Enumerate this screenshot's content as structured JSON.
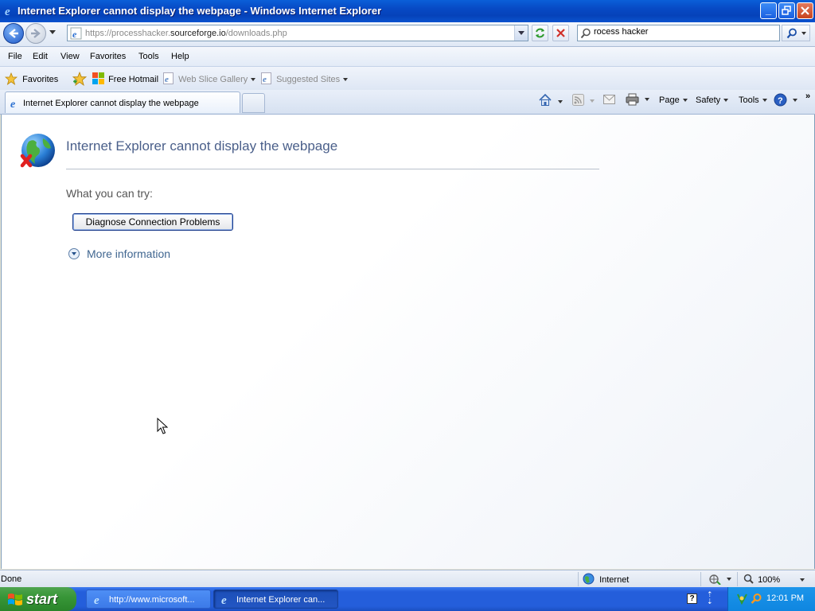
{
  "window": {
    "title": "Internet Explorer cannot display the webpage - Windows Internet Explorer"
  },
  "nav": {
    "url_prefix": "https://processhacker.",
    "url_domain": "sourceforge.io",
    "url_suffix": "/downloads.php",
    "search_value": "rocess hacker"
  },
  "menu": {
    "file": "File",
    "edit": "Edit",
    "view": "View",
    "favorites": "Favorites",
    "tools": "Tools",
    "help": "Help"
  },
  "favbar": {
    "favorites": "Favorites",
    "hotmail": "Free Hotmail",
    "web_slice": "Web Slice Gallery",
    "suggested": "Suggested Sites"
  },
  "tab": {
    "label": "Internet Explorer cannot display the webpage"
  },
  "commandbar": {
    "page": "Page",
    "safety": "Safety",
    "tools": "Tools"
  },
  "content": {
    "heading": "Internet Explorer cannot display the webpage",
    "try_label": "What you can try:",
    "diagnose_button": "Diagnose Connection Problems",
    "more_info": "More information"
  },
  "status": {
    "text": "Done",
    "zone": "Internet",
    "zoom": "100%"
  },
  "taskbar": {
    "start": "start",
    "task1": "http://www.microsoft...",
    "task2": "Internet Explorer can...",
    "clock": "12:01 PM"
  }
}
